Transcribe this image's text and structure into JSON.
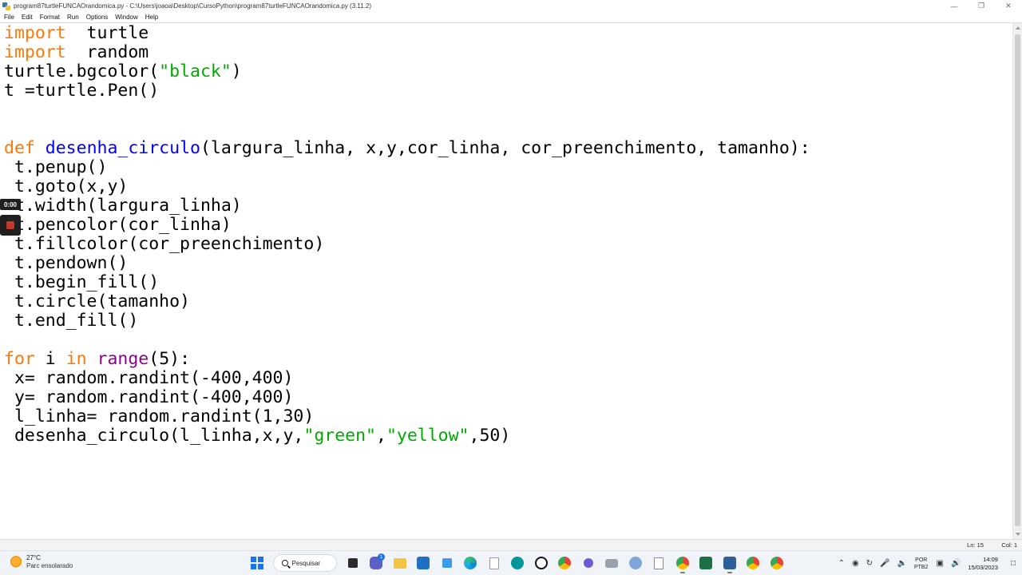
{
  "window": {
    "title": "program87turtleFUNCAOrandomica.py - C:\\Users\\joaoa\\Desktop\\CursoPython\\program87turtleFUNCAOrandomica.py (3.11.2)"
  },
  "menu": {
    "items": [
      {
        "label": "File"
      },
      {
        "label": "Edit"
      },
      {
        "label": "Format"
      },
      {
        "label": "Run"
      },
      {
        "label": "Options"
      },
      {
        "label": "Window"
      },
      {
        "label": "Help"
      }
    ]
  },
  "editor": {
    "lines": [
      [
        [
          "kw",
          "import"
        ],
        [
          "",
          "  turtle"
        ]
      ],
      [
        [
          "kw",
          "import"
        ],
        [
          "",
          "  random"
        ]
      ],
      [
        [
          "",
          "turtle.bgcolor("
        ],
        [
          "st",
          "\"black\""
        ],
        [
          "",
          ")"
        ]
      ],
      [
        [
          "",
          "t =turtle.Pen()"
        ]
      ],
      [],
      [],
      [
        [
          "kw",
          "def"
        ],
        [
          "",
          " "
        ],
        [
          "fn",
          "desenha_circulo"
        ],
        [
          "",
          "(largura_linha, x,y,cor_linha, cor_preenchimento, tamanho):"
        ]
      ],
      [
        [
          "",
          " t.penup()"
        ]
      ],
      [
        [
          "",
          " t.goto(x,y)"
        ]
      ],
      [
        [
          "",
          " t.width(largura_linha)"
        ]
      ],
      [
        [
          "",
          " t.pencolor(cor_linha)"
        ]
      ],
      [
        [
          "",
          " t.fillcolor(cor_preenchimento)"
        ]
      ],
      [
        [
          "",
          " t.pendown()"
        ]
      ],
      [
        [
          "",
          " t.begin_fill()"
        ]
      ],
      [
        [
          "",
          " t.circle(tamanho)"
        ]
      ],
      [
        [
          "",
          " t.end_fill()"
        ]
      ],
      [],
      [
        [
          "kw",
          "for"
        ],
        [
          "",
          " i "
        ],
        [
          "kw",
          "in"
        ],
        [
          "",
          " "
        ],
        [
          "bi",
          "range"
        ],
        [
          "",
          "(5):"
        ]
      ],
      [
        [
          "",
          " x= random.randint(-400,400)"
        ]
      ],
      [
        [
          "",
          " y= random.randint(-400,400)"
        ]
      ],
      [
        [
          "",
          " l_linha= random.randint(1,30)"
        ]
      ],
      [
        [
          "",
          " desenha_circulo(l_linha,x,y,"
        ],
        [
          "st",
          "\"green\""
        ],
        [
          "",
          ","
        ],
        [
          "st",
          "\"yellow\""
        ],
        [
          "",
          ",50)"
        ]
      ]
    ]
  },
  "status": {
    "ln": "Ln: 15",
    "col": "Col: 1"
  },
  "recording": {
    "time": "0:00"
  },
  "taskbar": {
    "weather_temp": "27°C",
    "weather_desc": "Parc ensolarado",
    "search_label": "Pesquisar",
    "chat_badge": "1",
    "lang_line1": "POR",
    "lang_line2": "PTB2",
    "time": "14:09",
    "date": "15/03/2023"
  },
  "colors": {
    "keyword": "#ff7700",
    "function_name": "#0000ff",
    "string": "#00aa00",
    "builtin": "#900090"
  }
}
